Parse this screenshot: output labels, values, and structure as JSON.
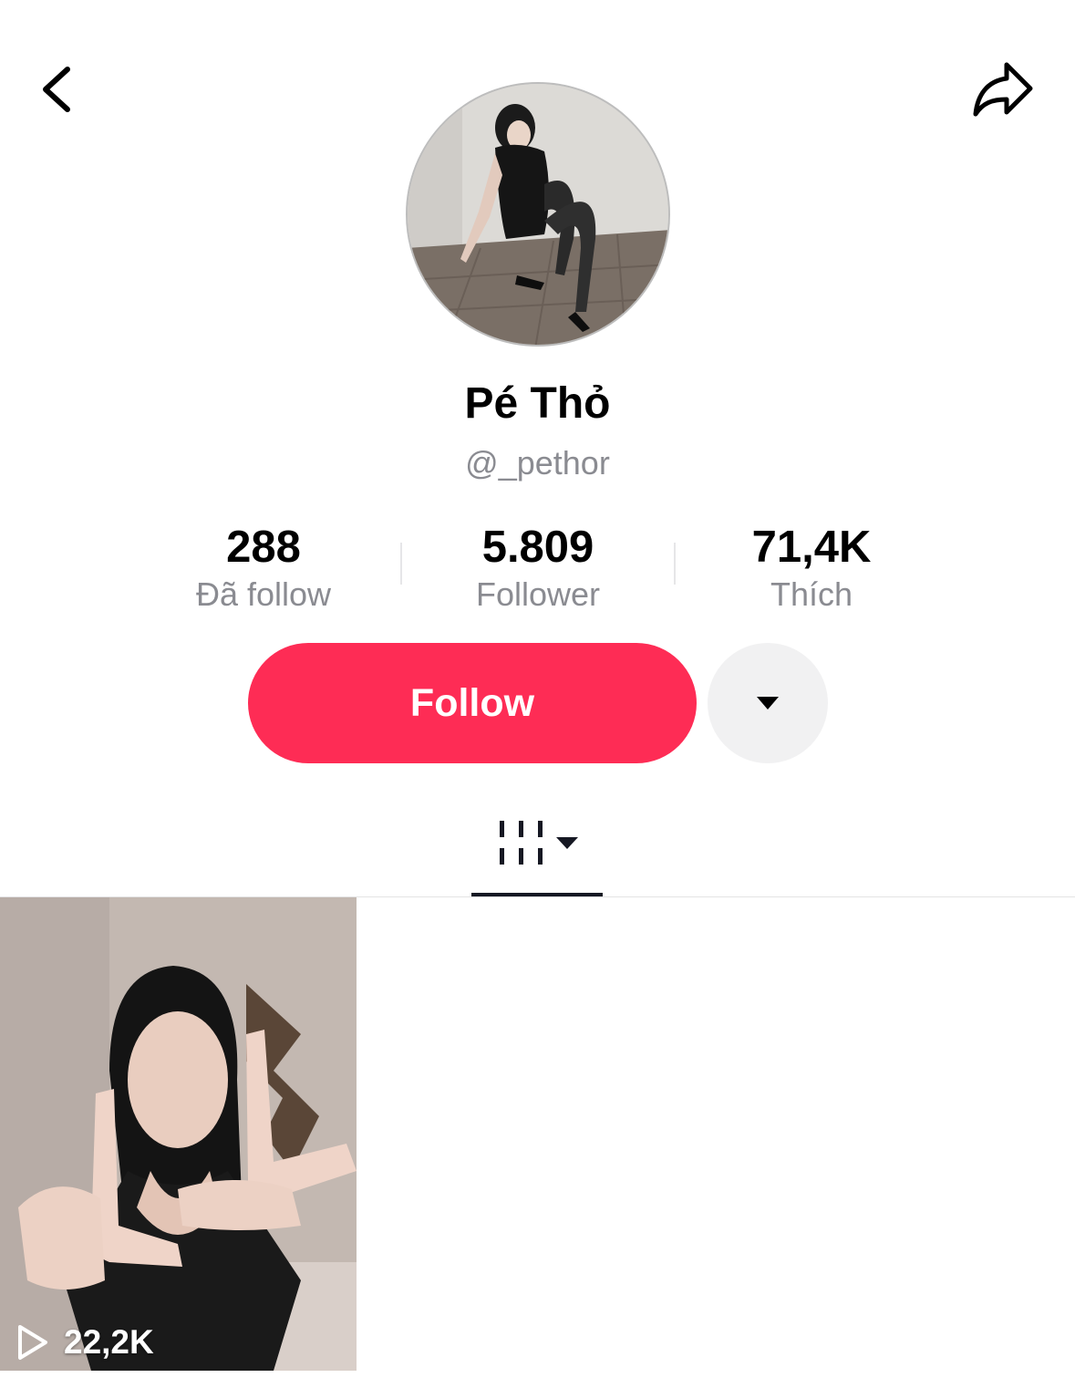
{
  "header": {
    "back_icon": "chevron-left-icon",
    "share_icon": "share-arrow-icon"
  },
  "profile": {
    "display_name": "Pé Thỏ",
    "username": "@_pethor"
  },
  "stats": [
    {
      "value": "288",
      "label": "Đã follow"
    },
    {
      "value": "5.809",
      "label": "Follower"
    },
    {
      "value": "71,4K",
      "label": "Thích"
    }
  ],
  "actions": {
    "follow_label": "Follow",
    "follow_color": "#fe2c55",
    "suggest_icon": "caret-down-icon"
  },
  "tabs": {
    "videos_icon": "video-grid-icon"
  },
  "videos": [
    {
      "views": "22,2K",
      "views_icon": "play-outline-icon"
    }
  ]
}
